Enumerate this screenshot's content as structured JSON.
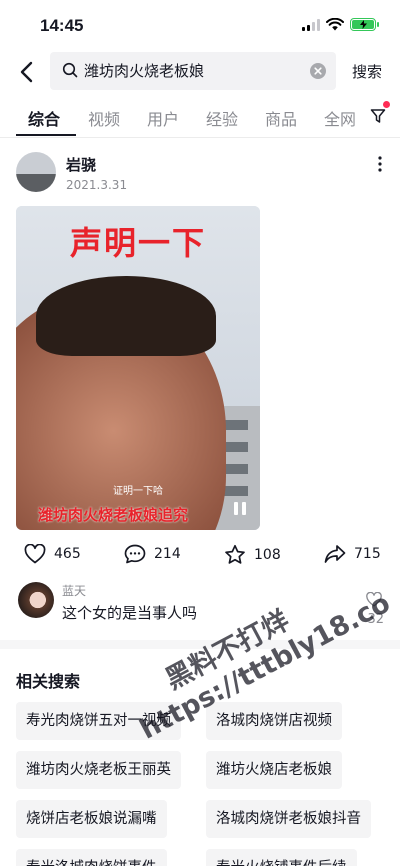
{
  "status_bar": {
    "time": "14:45"
  },
  "search": {
    "query": "潍坊肉火烧老板娘",
    "submit_label": "搜索"
  },
  "tabs": [
    "综合",
    "视频",
    "用户",
    "经验",
    "商品",
    "全网"
  ],
  "post": {
    "author": "岩骁",
    "date": "2021.3.31",
    "video": {
      "overlay_title": "声明一下",
      "caption": "证明一下哈",
      "banner": "潍坊肉火烧老板娘追究"
    },
    "stats": {
      "likes": "465",
      "comments": "214",
      "favorites": "108",
      "shares": "715"
    }
  },
  "top_comment": {
    "user": "蓝天",
    "text": "这个女的是当事人吗",
    "likes": "32"
  },
  "related": {
    "title": "相关搜索",
    "items": [
      "寿光肉烧饼五对一视频",
      "洛城肉烧饼店视频",
      "潍坊肉火烧老板王丽英",
      "潍坊火烧店老板娘",
      "烧饼店老板娘说漏嘴",
      "洛城肉烧饼老板娘抖音",
      "寿光洛城肉烧饼事件",
      "寿光火烧铺事件后续"
    ]
  },
  "watermark": {
    "line1": "黑料不打烊",
    "line2": "https://tttbly18.co"
  },
  "colors": {
    "accent": "#fe2c55",
    "battery": "#34c759",
    "video_title": "#e8232b"
  }
}
